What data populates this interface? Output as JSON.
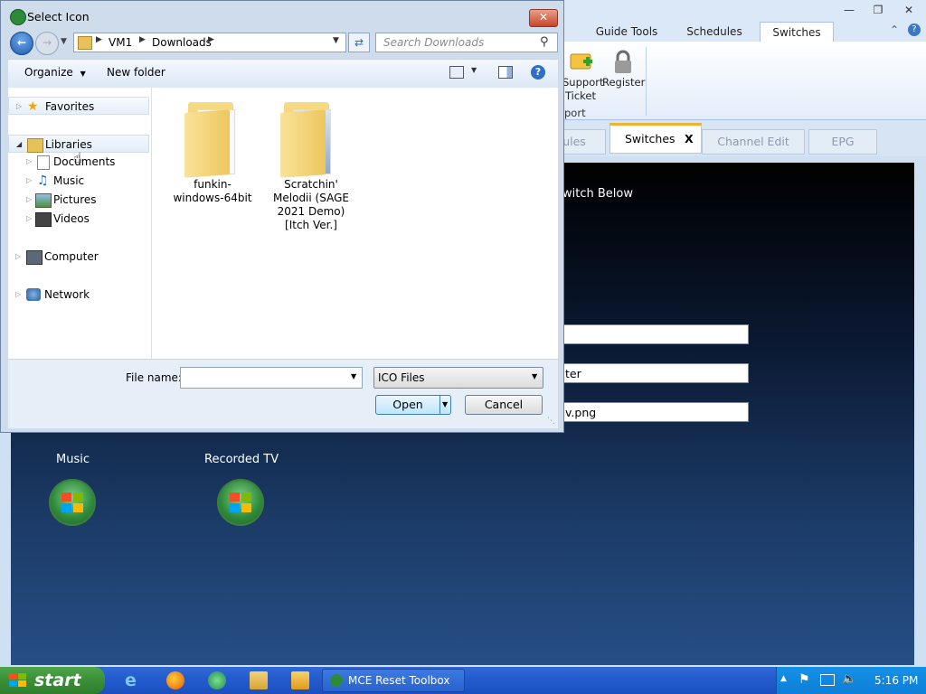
{
  "app": {
    "ribbon_tabs": [
      "Guide Tools",
      "Schedules",
      "Switches"
    ],
    "ribbon_buttons": [
      {
        "label_line1": "Support",
        "label_line2": "Ticket"
      },
      {
        "label_line1": "Register",
        "label_line2": ""
      }
    ],
    "ribbon_group_label": "port",
    "lower_tabs": [
      "ules",
      "Switches",
      "Channel Edit",
      "EPG"
    ],
    "close_tab_glyph": "X",
    "content_heading": "witch Below",
    "fields": [
      "",
      "ter",
      "v.png"
    ],
    "tiles": [
      {
        "label": "Music"
      },
      {
        "label": "Recorded TV"
      }
    ]
  },
  "dialog": {
    "title": "Select Icon",
    "breadcrumb": [
      "VM1",
      "Downloads"
    ],
    "search_placeholder": "Search Downloads",
    "toolbar": {
      "organize": "Organize",
      "new_folder": "New folder"
    },
    "nav": {
      "favorites": "Favorites",
      "libraries": "Libraries",
      "library_items": [
        "Documents",
        "Music",
        "Pictures",
        "Videos"
      ],
      "computer": "Computer",
      "network": "Network"
    },
    "files": [
      {
        "name": "funkin-windows-64bit"
      },
      {
        "name": "Scratchin' Melodii (SAGE 2021 Demo) [Itch Ver.]"
      }
    ],
    "file_name_label": "File name:",
    "file_name_value": "",
    "file_type": "ICO Files",
    "open_label": "Open",
    "cancel_label": "Cancel"
  },
  "taskbar": {
    "start_label": "start",
    "task_label": "MCE Reset Toolbox",
    "clock": "5:16 PM"
  }
}
